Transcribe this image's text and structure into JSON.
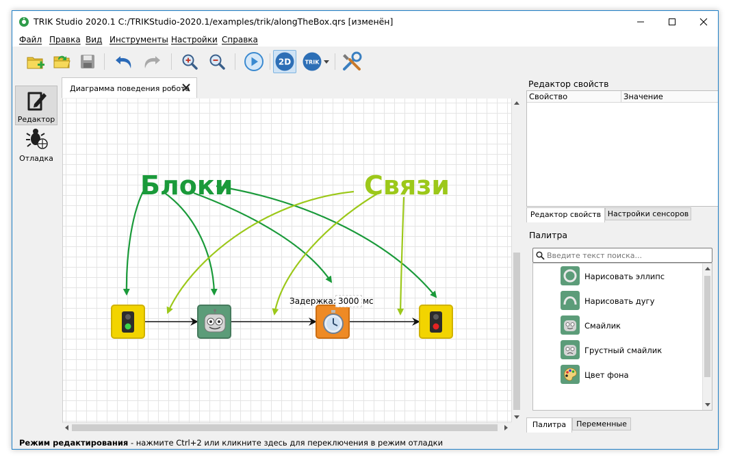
{
  "window": {
    "title": "TRIK Studio 2020.1 C:/TRIKStudio-2020.1/examples/trik/alongTheBox.qrs [изменён]"
  },
  "menu": {
    "items": [
      {
        "label": "Файл"
      },
      {
        "label": "Правка"
      },
      {
        "label": "Вид"
      },
      {
        "label": "Инструменты"
      },
      {
        "label": "Настройки"
      },
      {
        "label": "Справка"
      }
    ]
  },
  "toolbar": {
    "mode_2d_label": "2D",
    "trik_label": "TRIK"
  },
  "left_dock": {
    "editor_label": "Редактор",
    "debug_label": "Отладка"
  },
  "diagram": {
    "tab_title": "Диаграмма поведения робота",
    "annotation_blocks": "Блоки",
    "annotation_links": "Связи",
    "delay_label": "Задержка:",
    "delay_value": "3000",
    "delay_unit": "мс"
  },
  "property_editor": {
    "title": "Редактор свойств",
    "col_property": "Свойство",
    "col_value": "Значение",
    "tabs": [
      "Редактор свойств",
      "Настройки сенсоров"
    ]
  },
  "palette": {
    "title": "Палитра",
    "search_placeholder": "Введите текст поиска...",
    "items": [
      {
        "label": "Нарисовать эллипс",
        "icon": "ellipse-icon"
      },
      {
        "label": "Нарисовать дугу",
        "icon": "arc-icon"
      },
      {
        "label": "Смайлик",
        "icon": "smile-icon"
      },
      {
        "label": "Грустный смайлик",
        "icon": "sad-smile-icon"
      },
      {
        "label": "Цвет фона",
        "icon": "palette-icon"
      }
    ],
    "tabs": [
      "Палитра",
      "Переменные"
    ]
  },
  "status": {
    "mode": "Режим редактирования",
    "hint": " - нажмите Ctrl+2 или кликните здесь для переключения в режим отладки"
  },
  "colors": {
    "blocks_annotation": "#1a9a3a",
    "links_annotation": "#9cc81a",
    "accent": "#1e7fc7"
  }
}
